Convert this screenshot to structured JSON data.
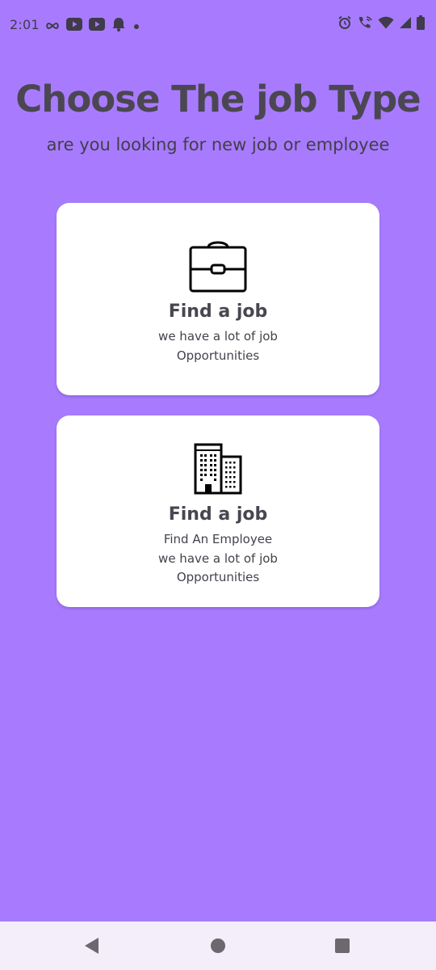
{
  "status_bar": {
    "time": "2:01",
    "left_icons": [
      "infinity-icon",
      "youtube-icon",
      "youtube-icon",
      "bell-icon",
      "dot-icon"
    ],
    "right_icons": [
      "alarm-icon",
      "wifi-calling-icon",
      "wifi-icon",
      "signal-icon",
      "battery-icon"
    ]
  },
  "header": {
    "title": "Choose The job Type",
    "subtitle": "are you looking for new job or employee"
  },
  "cards": [
    {
      "icon": "briefcase-icon",
      "title": "Find a job",
      "lines": [
        "we have a lot of job",
        "Opportunities"
      ]
    },
    {
      "icon": "building-icon",
      "title": "Find a job",
      "lines": [
        "Find An Employee",
        "we have a lot of job",
        "Opportunities"
      ]
    }
  ],
  "nav_bar": {
    "buttons": [
      "back-icon",
      "home-icon",
      "recents-icon"
    ]
  },
  "colors": {
    "background": "#a87bfe",
    "card": "#ffffff",
    "title_text": "#4b4752",
    "nav_bar": "#f4eefa"
  }
}
